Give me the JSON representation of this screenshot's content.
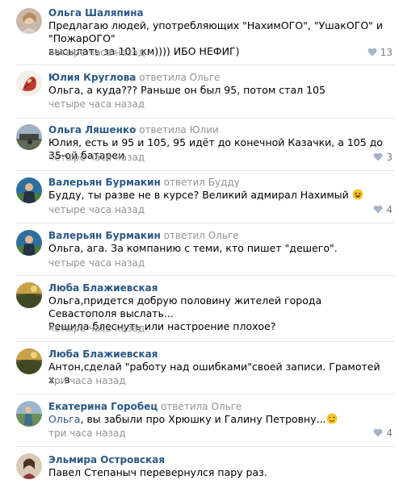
{
  "comments": [
    {
      "author": "Ольга Шаляпина",
      "reply_word": "",
      "reply_to": "",
      "lines": [
        "Предлагаю людей, употребляющих \"НахимОГО\", \"УшакОГО\" и \"ПожарОГО\"",
        "высылать за 101 км)))) ИБО НЕФИГ)"
      ],
      "time": "четыре часа назад",
      "likes": "13"
    },
    {
      "author": "Юлия Круглова",
      "reply_word": "ответила",
      "reply_to": "Ольге",
      "lines": [
        "Ольга, а куда??? Раньше он был 95, потом стал 105"
      ],
      "time": "четыре часа назад",
      "likes": ""
    },
    {
      "author": "Ольга Ляшенко",
      "reply_word": "ответила",
      "reply_to": "Юлии",
      "lines": [
        "Юлия, есть и 95 и 105, 95 идёт до конечной Казачки, а 105 до 35-ой батареи"
      ],
      "time": "четыре часа назад",
      "likes": "3"
    },
    {
      "author": "Валерьян Бурмакин",
      "reply_word": "ответил",
      "reply_to": "Будду",
      "lines": [
        "Будду, ты разве не в курсе? Великий адмирал Нахимый"
      ],
      "time": "четыре часа назад",
      "likes": "4"
    },
    {
      "author": "Валерьян Бурмакин",
      "reply_word": "ответил",
      "reply_to": "Ольге",
      "lines": [
        "Ольга, ага. За компанию с теми, кто пишет \"дешего\"."
      ],
      "time": "четыре часа назад",
      "likes": ""
    },
    {
      "author": "Люба Блажиевская",
      "reply_word": "",
      "reply_to": "",
      "lines": [
        "Ольга,придется добрую половину жителей города Севастополя выслать...",
        "Решила блеснуть или настроение плохое?"
      ],
      "time": "четыре часа назад",
      "likes": ""
    },
    {
      "author": "Люба Блажиевская",
      "reply_word": "",
      "reply_to": "",
      "lines": [
        "Антон,сделай \"работу над ошибками\"своей записи. Грамотей х...в"
      ],
      "time": "три часа назад",
      "likes": ""
    },
    {
      "author": "Екатерина Горобец",
      "reply_word": "ответила",
      "reply_to": "Ольге",
      "mention": "Ольга",
      "lines": [
        ", вы забыли про Хрюшку и Галину Петровну..."
      ],
      "time": "три часа назад",
      "likes": "4"
    },
    {
      "author": "Эльмира Островская",
      "reply_word": "",
      "reply_to": "",
      "lines": [
        "Павел Степаныч перевернулся пару раз."
      ],
      "time": "",
      "likes": ""
    }
  ],
  "icons": {
    "like": "heart-icon",
    "emoji_laugh": "laughing-emoji-icon",
    "emoji_wink": "winking-emoji-icon"
  },
  "colors": {
    "link": "#2a5885",
    "muted": "#939393",
    "separator": "#e7e8ec",
    "like": "#6f7985"
  }
}
